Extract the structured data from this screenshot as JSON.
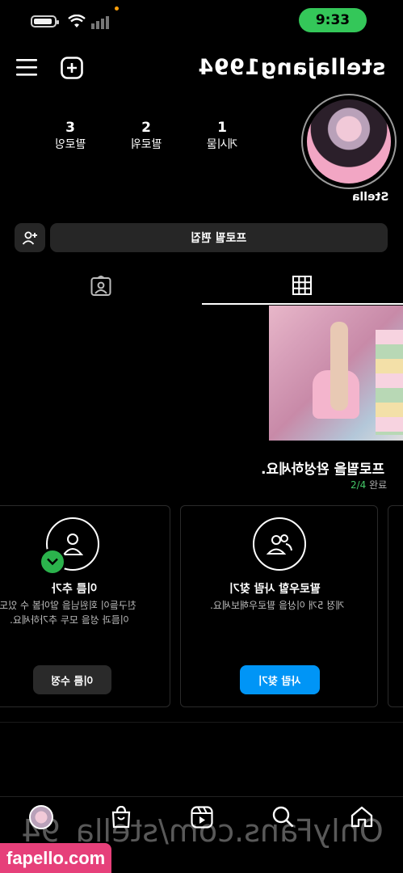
{
  "status": {
    "time": "9:33"
  },
  "header": {
    "username": "stellajang1994"
  },
  "profile": {
    "display_name": "Stella",
    "stats": [
      {
        "num": "1",
        "label": "게시물"
      },
      {
        "num": "2",
        "label": "팔로워"
      },
      {
        "num": "3",
        "label": "팔로잉"
      }
    ],
    "edit_button": "프로필 편집"
  },
  "completion": {
    "title": "프로필을 완성하세요.",
    "progress_count": "2/4",
    "progress_label": "완료"
  },
  "cards": [
    {
      "title": "팔로우할 사람 찾기",
      "desc": "게정 5개 이상을 팔로우해보세요.",
      "button": "사람 찾기"
    },
    {
      "title": "이름 추가",
      "desc_line1": "친구들이 회원님을 알아볼 수 있도록",
      "desc_line2": "이름과 성을 모두 추가하세요.",
      "button": "이름 수정"
    }
  ],
  "watermark": {
    "text": "OnlyFans.com/stella_94",
    "badge": "fapello.com"
  },
  "colors": {
    "accent_blue": "#0095f6",
    "status_green": "#34c759",
    "badge_pink": "#e6407a"
  }
}
